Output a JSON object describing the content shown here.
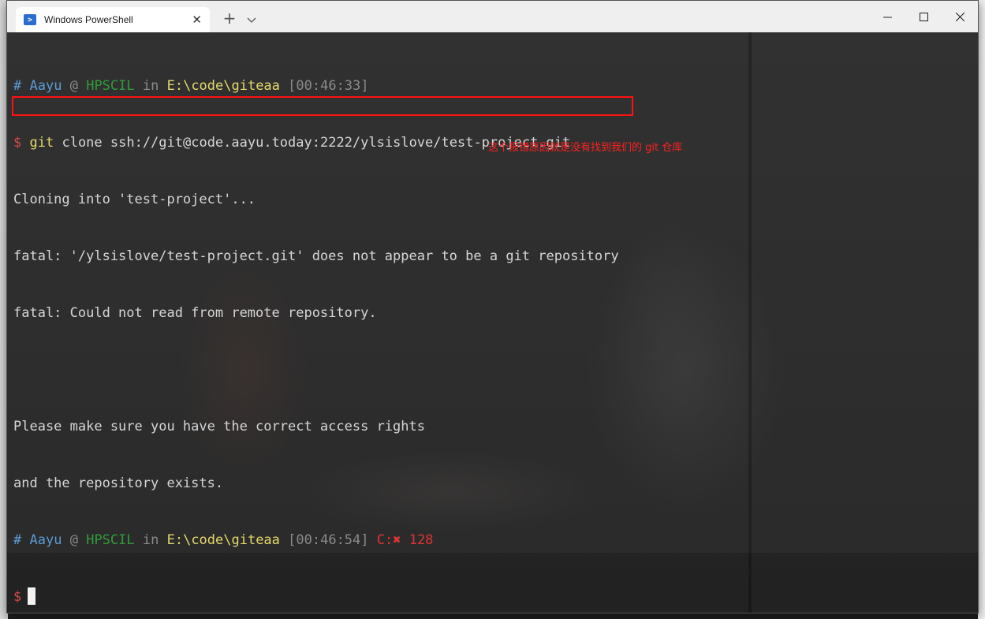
{
  "window": {
    "tab_title": "Windows PowerShell",
    "tab_icon": "powershell-icon",
    "new_tab": "+",
    "tab_close": "✕"
  },
  "terminal": {
    "prompt1": {
      "hash": "#",
      "user": "Aayu",
      "at": "@",
      "host": "HPSCIL",
      "in": "in",
      "path": "E:\\code\\giteaa",
      "time": "[00:46:33]"
    },
    "command_line": {
      "dollar": "$",
      "git": "git",
      "args": "clone ssh://git@code.aayu.today:2222/ylsislove/test-project.git"
    },
    "output": [
      "Cloning into 'test-project'...",
      "fatal: '/ylsislove/test-project.git' does not appear to be a git repository",
      "fatal: Could not read from remote repository.",
      "",
      "Please make sure you have the correct access rights",
      "and the repository exists."
    ],
    "prompt2": {
      "hash": "#",
      "user": "Aayu",
      "at": "@",
      "host": "HPSCIL",
      "in": "in",
      "path": "E:\\code\\giteaa",
      "time": "[00:46:54]",
      "exit": "C:✖ 128"
    },
    "final_prompt": "$"
  },
  "annotation": {
    "text": "这个报错原因就是没有找到我们的 git 仓库"
  },
  "colors": {
    "user": "#5b9bd5",
    "host": "#2f9a3a",
    "path": "#e5d86b",
    "dollar": "#d74a4a",
    "error_box": "#ff1111",
    "annotation": "#ff2020",
    "text": "#d6d6d6"
  }
}
